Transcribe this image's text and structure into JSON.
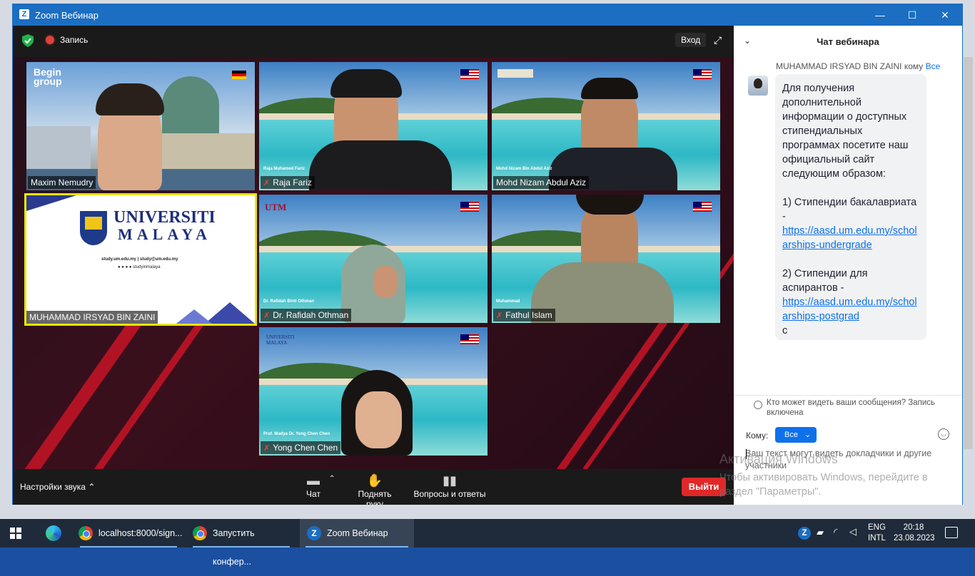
{
  "window": {
    "title": "Zoom Вебинар",
    "minimize": "—",
    "maximize": "☐",
    "close": "✕"
  },
  "topbar": {
    "record_label": "Запись",
    "enter_label": "Вход"
  },
  "tiles": [
    {
      "name": "Maxim Nemudry",
      "muted": false,
      "logo": "Begin\ngroup"
    },
    {
      "name": "Raja Fariz",
      "muted": true,
      "caption": "Raja Muhamed Fariz"
    },
    {
      "name": "Mohd Nizam Abdul Aziz",
      "muted": false,
      "caption": "Mohd Nizam Bin Abdul Aziz"
    },
    {
      "name": "MUHAMMAD IRSYAD BIN ZAINI",
      "muted": false,
      "uni_line1": "UNIVERSITI",
      "uni_line2": "MALAYA",
      "uni_contact": "study.um.edu.my  |  study@um.edu.my",
      "uni_social": "studyinmalaya"
    },
    {
      "name": "Dr. Rafidah Othman",
      "muted": true,
      "caption": "Dr. Rafidah Binti Othman",
      "logo": "UTM"
    },
    {
      "name": "Fathul Islam",
      "muted": true,
      "caption": "Muhammad"
    },
    {
      "name": "Yong Chen Chen",
      "muted": true,
      "caption": "Prof. Madya Dr. Yong Chen Chen",
      "logo": "UNIVERSITI MALAYA"
    }
  ],
  "controls": {
    "audio_settings": "Настройки звука",
    "chat": "Чат",
    "raise_hand": "Поднять руку",
    "qa": "Вопросы и ответы",
    "leave": "Выйти"
  },
  "chat": {
    "title": "Чат вебинара",
    "sender": "MUHAMMAD IRSYAD BIN ZAINI",
    "to_word": "кому",
    "to_target": "Все",
    "message_intro": "Для получения дополнительной информации о доступных стипендиальных программах посетите наш официальный сайт следующим образом:",
    "item1": "1) Стипендии бакалавриата -",
    "link1": "https://aasd.um.edu.my/scholarships-undergrade",
    "item2": "2) Стипендии для аспирантов -",
    "link2": "https://aasd.um.edu.my/scholarships-postgrad",
    "trailing": "c",
    "visibility_note": "Кто может видеть ваши сообщения? Запись включена",
    "to_label": "Кому:",
    "to_value": "Все",
    "input_placeholder": "Ваш текст могут видеть докладчики и другие участники",
    "watermark_title": "Активация Windows",
    "watermark_text": "Чтобы активировать Windows, перейдите в раздел \"Параметры\"."
  },
  "taskbar": {
    "items": [
      "localhost:8000/sign...",
      "Запустить конфер...",
      "Zoom Вебинар"
    ],
    "lang1": "ENG",
    "lang2": "INTL",
    "time": "20:18",
    "date": "23.08.2023"
  },
  "colors": {
    "zoom_blue": "#1b6ec2",
    "leave_red": "#e02828",
    "link_blue": "#0e71eb",
    "active_speaker": "#e6e600"
  }
}
